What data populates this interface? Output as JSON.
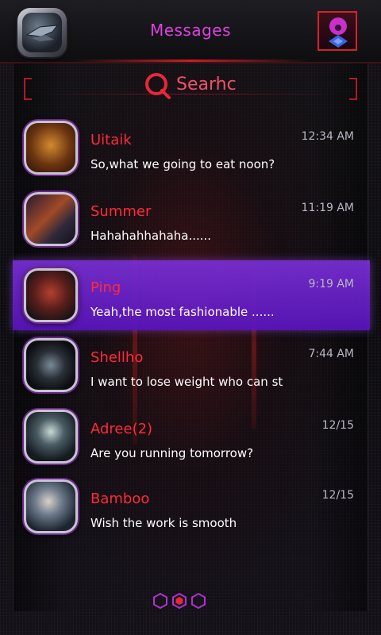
{
  "header": {
    "title": "Messages",
    "app_icon": "robot-ship-icon",
    "profile_icon": "alien-profile-icon"
  },
  "search": {
    "label": "Searhc",
    "icon": "search-icon"
  },
  "conversations": [
    {
      "name": "Uitaik",
      "preview": "So,what we going to eat noon?",
      "time": "12:34 AM",
      "selected": false
    },
    {
      "name": "Summer",
      "preview": "Hahahahhahaha......",
      "time": "11:19 AM",
      "selected": false
    },
    {
      "name": "Ping",
      "preview": "Yeah,the most fashionable ......",
      "time": "9:19 AM",
      "selected": true
    },
    {
      "name": "Shellho",
      "preview": "I want to lose weight who can st",
      "time": "7:44 AM",
      "selected": false
    },
    {
      "name": "Adree(2)",
      "preview": "Are you running tomorrow?",
      "time": "12/15",
      "selected": false
    },
    {
      "name": "Bamboo",
      "preview": "Wish the work is smooth",
      "time": "12/15",
      "selected": false
    }
  ],
  "pager": {
    "pages": 3,
    "current": 2
  },
  "colors": {
    "title": "#e040e0",
    "name": "#ff2a3a",
    "accent_red": "#d6202e",
    "selection": "#7a30e0",
    "pager": "#b030d0"
  }
}
